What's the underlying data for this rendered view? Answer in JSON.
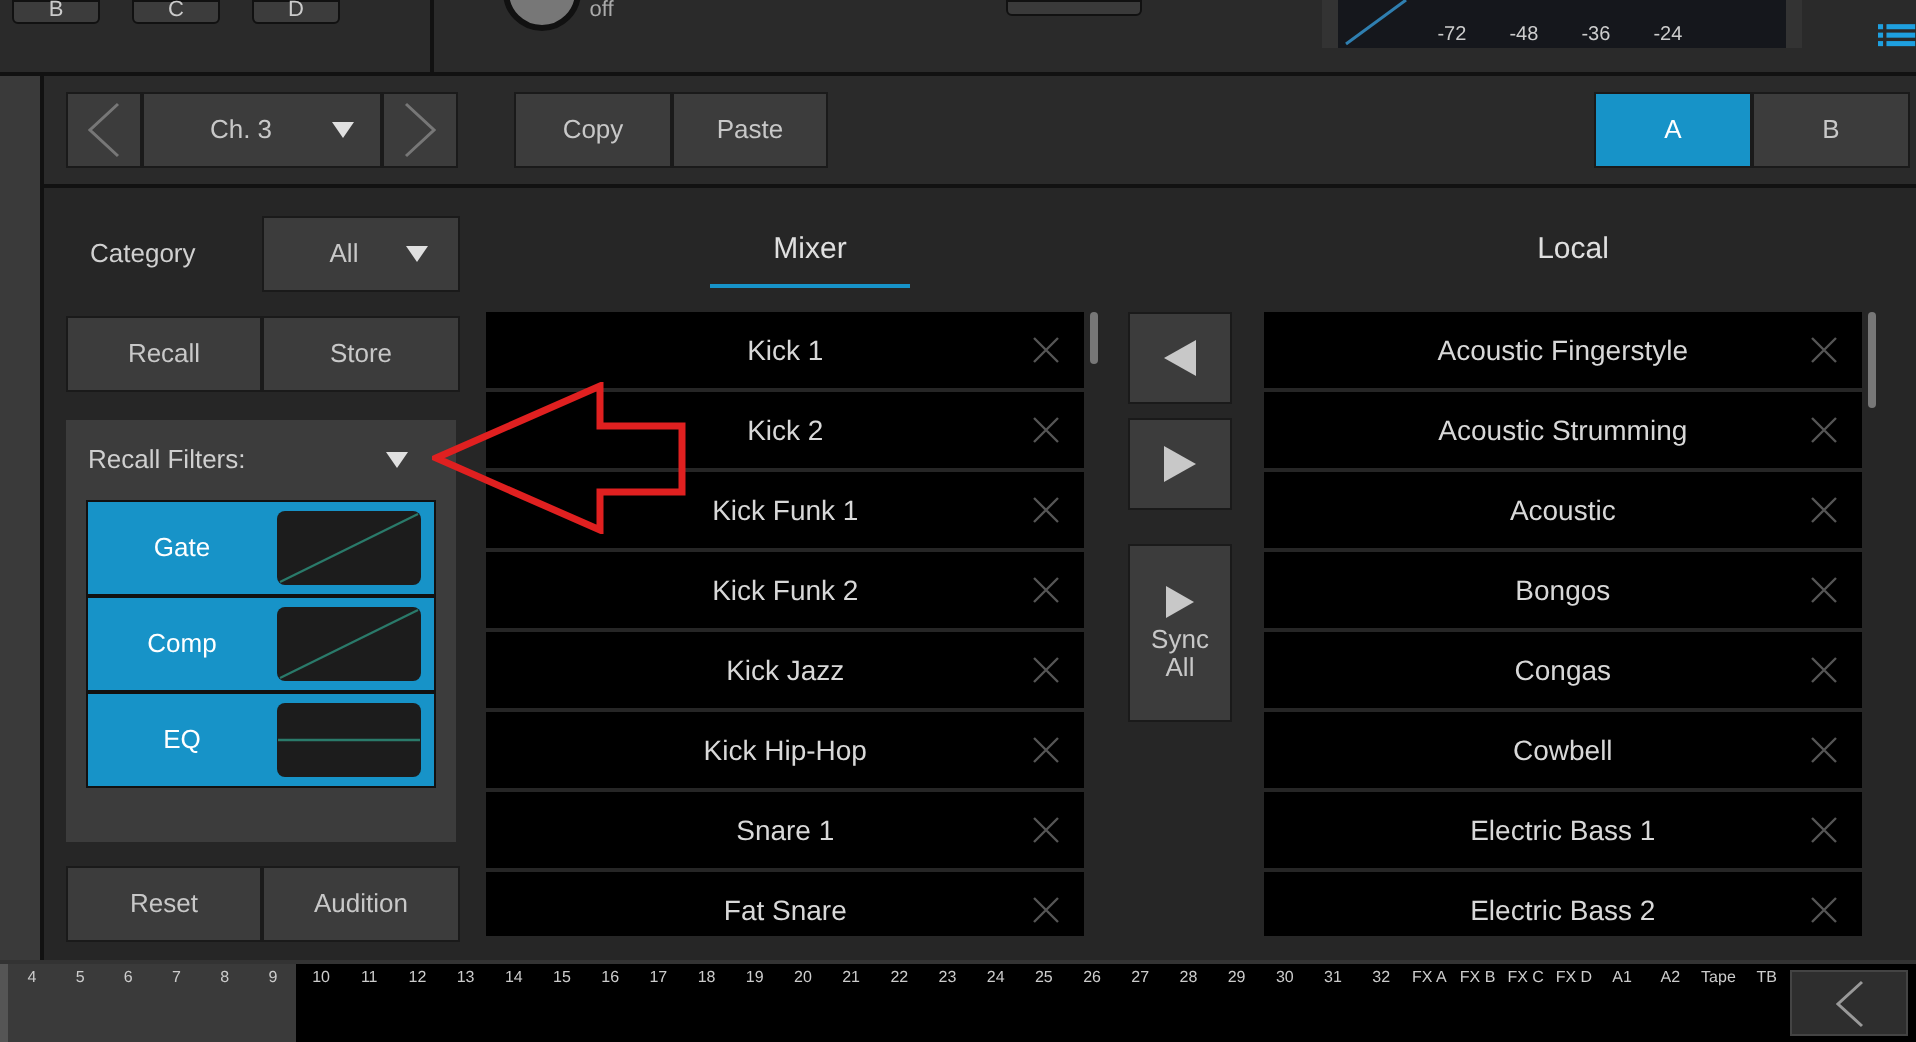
{
  "top_bar": {
    "scene_buttons": [
      "B",
      "C",
      "D"
    ],
    "knob_label": "off",
    "meter_ticks": [
      "-72",
      "-48",
      "-36",
      "-24"
    ]
  },
  "nav": {
    "channel": "Ch. 3",
    "copy": "Copy",
    "paste": "Paste",
    "ab": [
      {
        "label": "A",
        "selected": true
      },
      {
        "label": "B",
        "selected": false
      }
    ]
  },
  "category": {
    "label": "Category",
    "value": "All"
  },
  "recall": "Recall",
  "store": "Store",
  "recall_filters": {
    "title": "Recall Filters:",
    "filters": [
      {
        "label": "Gate",
        "on": true,
        "kind": "diagonal"
      },
      {
        "label": "Comp",
        "on": true,
        "kind": "diagonal"
      },
      {
        "label": "EQ",
        "on": true,
        "kind": "flat"
      }
    ]
  },
  "reset": "Reset",
  "audition": "Audition",
  "tabs": [
    {
      "label": "Mixer",
      "selected": true
    },
    {
      "label": "Local",
      "selected": false
    }
  ],
  "mixer_presets": [
    "Kick 1",
    "Kick 2",
    "Kick Funk 1",
    "Kick Funk 2",
    "Kick Jazz",
    "Kick Hip-Hop",
    "Snare 1",
    "Fat Snare"
  ],
  "local_presets": [
    "Acoustic Fingerstyle",
    "Acoustic Strumming",
    "Acoustic",
    "Bongos",
    "Congas",
    "Cowbell",
    "Electric Bass 1",
    "Electric Bass 2"
  ],
  "sync_all": "Sync\nAll",
  "channel_strip": [
    {
      "label": "4",
      "selected": true
    },
    {
      "label": "5",
      "selected": true
    },
    {
      "label": "6",
      "selected": true
    },
    {
      "label": "7",
      "selected": true
    },
    {
      "label": "8",
      "selected": true
    },
    {
      "label": "9",
      "selected": true
    },
    {
      "label": "10",
      "selected": false
    },
    {
      "label": "11",
      "selected": false
    },
    {
      "label": "12",
      "selected": false
    },
    {
      "label": "13",
      "selected": false
    },
    {
      "label": "14",
      "selected": false
    },
    {
      "label": "15",
      "selected": false
    },
    {
      "label": "16",
      "selected": false
    },
    {
      "label": "17",
      "selected": false
    },
    {
      "label": "18",
      "selected": false
    },
    {
      "label": "19",
      "selected": false
    },
    {
      "label": "20",
      "selected": false
    },
    {
      "label": "21",
      "selected": false
    },
    {
      "label": "22",
      "selected": false
    },
    {
      "label": "23",
      "selected": false
    },
    {
      "label": "24",
      "selected": false
    },
    {
      "label": "25",
      "selected": false
    },
    {
      "label": "26",
      "selected": false
    },
    {
      "label": "27",
      "selected": false
    },
    {
      "label": "28",
      "selected": false
    },
    {
      "label": "29",
      "selected": false
    },
    {
      "label": "30",
      "selected": false
    },
    {
      "label": "31",
      "selected": false
    },
    {
      "label": "32",
      "selected": false
    },
    {
      "label": "FX A",
      "selected": false
    },
    {
      "label": "FX B",
      "selected": false
    },
    {
      "label": "FX C",
      "selected": false
    },
    {
      "label": "FX D",
      "selected": false
    },
    {
      "label": "A1",
      "selected": false
    },
    {
      "label": "A2",
      "selected": false
    },
    {
      "label": "Tape",
      "selected": false
    },
    {
      "label": "TB",
      "selected": false
    }
  ]
}
